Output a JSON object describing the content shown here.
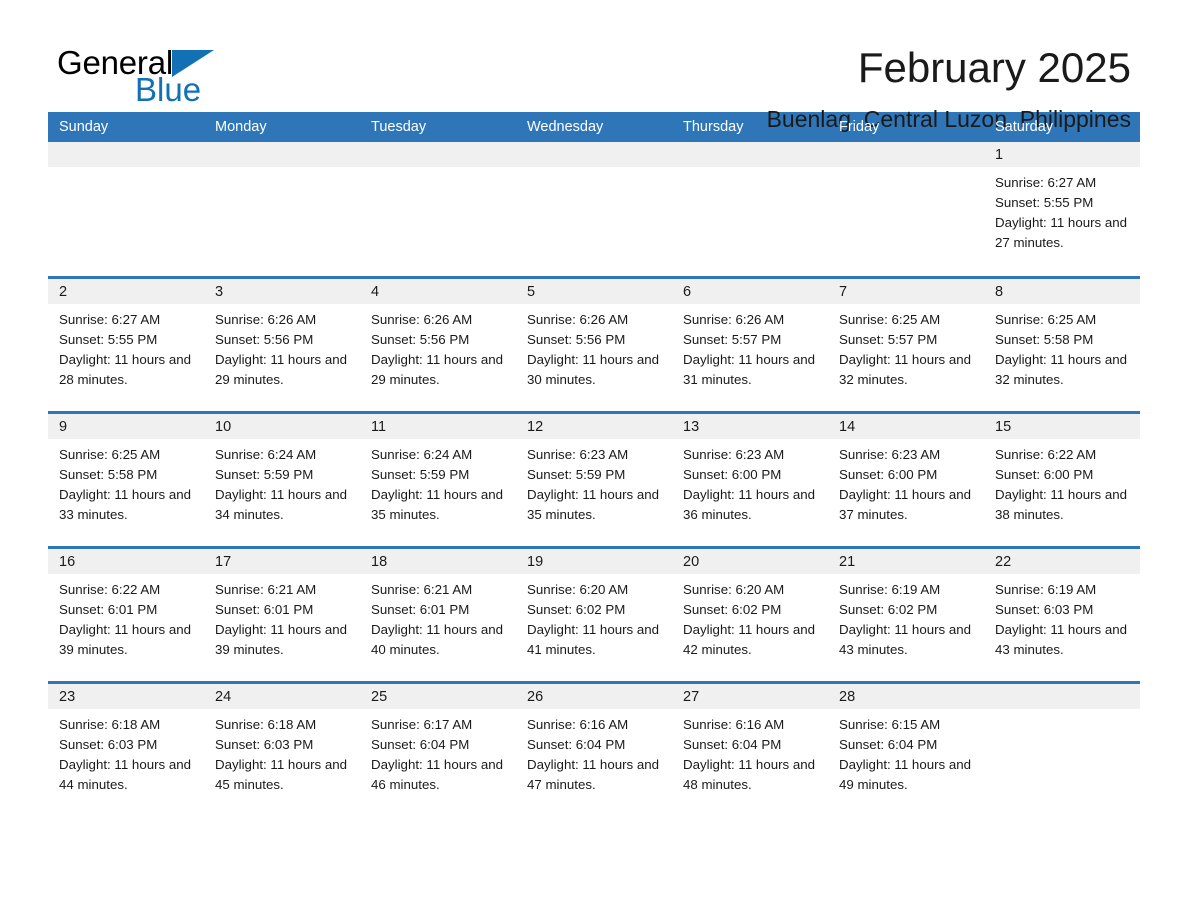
{
  "logo": {
    "word_one": "General",
    "word_two": "Blue",
    "triangle_color": "#1271b5"
  },
  "header": {
    "title": "February 2025",
    "subtitle": "Buenlag, Central Luzon, Philippines"
  },
  "theme": {
    "header_blue": "#2e76b8",
    "day_band_gray": "#f0f0f0",
    "text": "#1a1a1a"
  },
  "weekdays": [
    "Sunday",
    "Monday",
    "Tuesday",
    "Wednesday",
    "Thursday",
    "Friday",
    "Saturday"
  ],
  "weeks": [
    [
      {
        "day": "",
        "sunrise": "",
        "sunset": "",
        "daylight": "",
        "empty": true
      },
      {
        "day": "",
        "sunrise": "",
        "sunset": "",
        "daylight": "",
        "empty": true
      },
      {
        "day": "",
        "sunrise": "",
        "sunset": "",
        "daylight": "",
        "empty": true
      },
      {
        "day": "",
        "sunrise": "",
        "sunset": "",
        "daylight": "",
        "empty": true
      },
      {
        "day": "",
        "sunrise": "",
        "sunset": "",
        "daylight": "",
        "empty": true
      },
      {
        "day": "",
        "sunrise": "",
        "sunset": "",
        "daylight": "",
        "empty": true
      },
      {
        "day": "1",
        "sunrise": "Sunrise: 6:27 AM",
        "sunset": "Sunset: 5:55 PM",
        "daylight": "Daylight: 11 hours and 27 minutes.",
        "empty": false
      }
    ],
    [
      {
        "day": "2",
        "sunrise": "Sunrise: 6:27 AM",
        "sunset": "Sunset: 5:55 PM",
        "daylight": "Daylight: 11 hours and 28 minutes.",
        "empty": false
      },
      {
        "day": "3",
        "sunrise": "Sunrise: 6:26 AM",
        "sunset": "Sunset: 5:56 PM",
        "daylight": "Daylight: 11 hours and 29 minutes.",
        "empty": false
      },
      {
        "day": "4",
        "sunrise": "Sunrise: 6:26 AM",
        "sunset": "Sunset: 5:56 PM",
        "daylight": "Daylight: 11 hours and 29 minutes.",
        "empty": false
      },
      {
        "day": "5",
        "sunrise": "Sunrise: 6:26 AM",
        "sunset": "Sunset: 5:56 PM",
        "daylight": "Daylight: 11 hours and 30 minutes.",
        "empty": false
      },
      {
        "day": "6",
        "sunrise": "Sunrise: 6:26 AM",
        "sunset": "Sunset: 5:57 PM",
        "daylight": "Daylight: 11 hours and 31 minutes.",
        "empty": false
      },
      {
        "day": "7",
        "sunrise": "Sunrise: 6:25 AM",
        "sunset": "Sunset: 5:57 PM",
        "daylight": "Daylight: 11 hours and 32 minutes.",
        "empty": false
      },
      {
        "day": "8",
        "sunrise": "Sunrise: 6:25 AM",
        "sunset": "Sunset: 5:58 PM",
        "daylight": "Daylight: 11 hours and 32 minutes.",
        "empty": false
      }
    ],
    [
      {
        "day": "9",
        "sunrise": "Sunrise: 6:25 AM",
        "sunset": "Sunset: 5:58 PM",
        "daylight": "Daylight: 11 hours and 33 minutes.",
        "empty": false
      },
      {
        "day": "10",
        "sunrise": "Sunrise: 6:24 AM",
        "sunset": "Sunset: 5:59 PM",
        "daylight": "Daylight: 11 hours and 34 minutes.",
        "empty": false
      },
      {
        "day": "11",
        "sunrise": "Sunrise: 6:24 AM",
        "sunset": "Sunset: 5:59 PM",
        "daylight": "Daylight: 11 hours and 35 minutes.",
        "empty": false
      },
      {
        "day": "12",
        "sunrise": "Sunrise: 6:23 AM",
        "sunset": "Sunset: 5:59 PM",
        "daylight": "Daylight: 11 hours and 35 minutes.",
        "empty": false
      },
      {
        "day": "13",
        "sunrise": "Sunrise: 6:23 AM",
        "sunset": "Sunset: 6:00 PM",
        "daylight": "Daylight: 11 hours and 36 minutes.",
        "empty": false
      },
      {
        "day": "14",
        "sunrise": "Sunrise: 6:23 AM",
        "sunset": "Sunset: 6:00 PM",
        "daylight": "Daylight: 11 hours and 37 minutes.",
        "empty": false
      },
      {
        "day": "15",
        "sunrise": "Sunrise: 6:22 AM",
        "sunset": "Sunset: 6:00 PM",
        "daylight": "Daylight: 11 hours and 38 minutes.",
        "empty": false
      }
    ],
    [
      {
        "day": "16",
        "sunrise": "Sunrise: 6:22 AM",
        "sunset": "Sunset: 6:01 PM",
        "daylight": "Daylight: 11 hours and 39 minutes.",
        "empty": false
      },
      {
        "day": "17",
        "sunrise": "Sunrise: 6:21 AM",
        "sunset": "Sunset: 6:01 PM",
        "daylight": "Daylight: 11 hours and 39 minutes.",
        "empty": false
      },
      {
        "day": "18",
        "sunrise": "Sunrise: 6:21 AM",
        "sunset": "Sunset: 6:01 PM",
        "daylight": "Daylight: 11 hours and 40 minutes.",
        "empty": false
      },
      {
        "day": "19",
        "sunrise": "Sunrise: 6:20 AM",
        "sunset": "Sunset: 6:02 PM",
        "daylight": "Daylight: 11 hours and 41 minutes.",
        "empty": false
      },
      {
        "day": "20",
        "sunrise": "Sunrise: 6:20 AM",
        "sunset": "Sunset: 6:02 PM",
        "daylight": "Daylight: 11 hours and 42 minutes.",
        "empty": false
      },
      {
        "day": "21",
        "sunrise": "Sunrise: 6:19 AM",
        "sunset": "Sunset: 6:02 PM",
        "daylight": "Daylight: 11 hours and 43 minutes.",
        "empty": false
      },
      {
        "day": "22",
        "sunrise": "Sunrise: 6:19 AM",
        "sunset": "Sunset: 6:03 PM",
        "daylight": "Daylight: 11 hours and 43 minutes.",
        "empty": false
      }
    ],
    [
      {
        "day": "23",
        "sunrise": "Sunrise: 6:18 AM",
        "sunset": "Sunset: 6:03 PM",
        "daylight": "Daylight: 11 hours and 44 minutes.",
        "empty": false
      },
      {
        "day": "24",
        "sunrise": "Sunrise: 6:18 AM",
        "sunset": "Sunset: 6:03 PM",
        "daylight": "Daylight: 11 hours and 45 minutes.",
        "empty": false
      },
      {
        "day": "25",
        "sunrise": "Sunrise: 6:17 AM",
        "sunset": "Sunset: 6:04 PM",
        "daylight": "Daylight: 11 hours and 46 minutes.",
        "empty": false
      },
      {
        "day": "26",
        "sunrise": "Sunrise: 6:16 AM",
        "sunset": "Sunset: 6:04 PM",
        "daylight": "Daylight: 11 hours and 47 minutes.",
        "empty": false
      },
      {
        "day": "27",
        "sunrise": "Sunrise: 6:16 AM",
        "sunset": "Sunset: 6:04 PM",
        "daylight": "Daylight: 11 hours and 48 minutes.",
        "empty": false
      },
      {
        "day": "28",
        "sunrise": "Sunrise: 6:15 AM",
        "sunset": "Sunset: 6:04 PM",
        "daylight": "Daylight: 11 hours and 49 minutes.",
        "empty": false
      },
      {
        "day": "",
        "sunrise": "",
        "sunset": "",
        "daylight": "",
        "empty": true
      }
    ]
  ]
}
